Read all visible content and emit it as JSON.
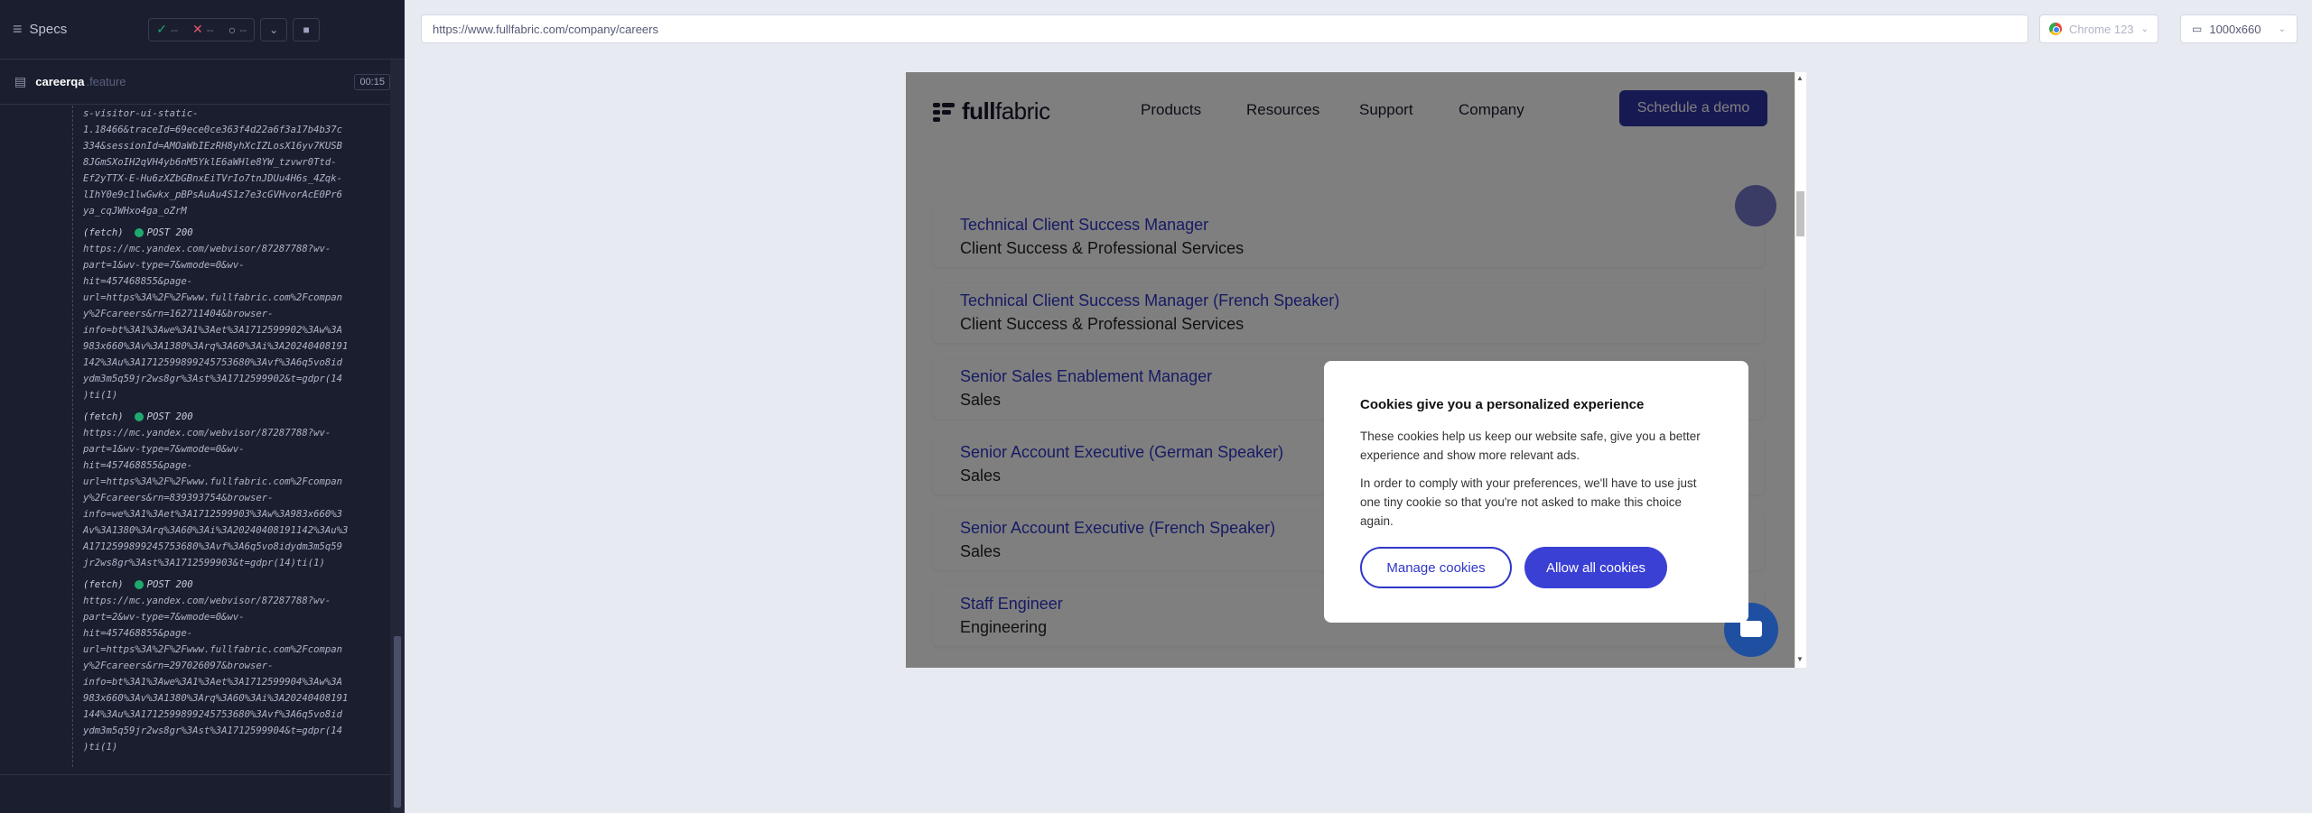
{
  "runner": {
    "title": "Specs",
    "stats": {
      "passed": "--",
      "failed": "--",
      "pending": "--"
    },
    "spec": {
      "name": "careerqa",
      "ext": ".feature",
      "time": "00:15"
    },
    "log_pre": [
      "s-visitor-ui-static-",
      "1.18466&traceId=69ece0ce363f4d22a6f3a17b4b37c",
      "334&sessionId=AMOaWbIEzRH8yhXcIZLosX16yv7KUSB",
      "8JGmSXoIH2qVH4yb6nM5YklE6aWHle8YW_tzvwr0Ttd-",
      "Ef2yTTX-E-Hu6zXZbGBnxEiTVrIo7tnJDUu4H6s_4Zqk-",
      "lIhY0e9c1lwGwkx_pBPsAuAu4S1z7e3cGVHvorAcE0Pr6",
      "ya_cqJWHxo4ga_oZrM"
    ],
    "log_entries": [
      {
        "label": "(fetch)",
        "status": "POST 200",
        "lines": [
          "https://mc.yandex.com/webvisor/87287788?wv-",
          "part=1&wv-type=7&wmode=0&wv-",
          "hit=457468855&page-",
          "url=https%3A%2F%2Fwww.fullfabric.com%2Fcompan",
          "y%2Fcareers&rn=162711404&browser-",
          "info=bt%3A1%3Awe%3A1%3Aet%3A1712599902%3Aw%3A",
          "983x660%3Av%3A1380%3Arq%3A60%3Ai%3A20240408191",
          "142%3Au%3A1712599899245753680%3Avf%3A6q5vo8id",
          "ydm3m5q59jr2ws8gr%3Ast%3A1712599902&t=gdpr(14",
          ")ti(1)"
        ]
      },
      {
        "label": "(fetch)",
        "status": "POST 200",
        "lines": [
          "https://mc.yandex.com/webvisor/87287788?wv-",
          "part=1&wv-type=7&wmode=0&wv-",
          "hit=457468855&page-",
          "url=https%3A%2F%2Fwww.fullfabric.com%2Fcompan",
          "y%2Fcareers&rn=839393754&browser-",
          "info=we%3A1%3Aet%3A1712599903%3Aw%3A983x660%3",
          "Av%3A1380%3Arq%3A60%3Ai%3A20240408191142%3Au%3",
          "A1712599899245753680%3Avf%3A6q5vo8idydm3m5q59",
          "jr2ws8gr%3Ast%3A1712599903&t=gdpr(14)ti(1)"
        ]
      },
      {
        "label": "(fetch)",
        "status": "POST 200",
        "lines": [
          "https://mc.yandex.com/webvisor/87287788?wv-",
          "part=2&wv-type=7&wmode=0&wv-",
          "hit=457468855&page-",
          "url=https%3A%2F%2Fwww.fullfabric.com%2Fcompan",
          "y%2Fcareers&rn=297026097&browser-",
          "info=bt%3A1%3Awe%3A1%3Aet%3A1712599904%3Aw%3A",
          "983x660%3Av%3A1380%3Arq%3A60%3Ai%3A20240408191",
          "144%3Au%3A1712599899245753680%3Avf%3A6q5vo8id",
          "ydm3m5q59jr2ws8gr%3Ast%3A1712599904&t=gdpr(14",
          ")ti(1)"
        ]
      }
    ]
  },
  "browser": {
    "url": "https://www.fullfabric.com/company/careers",
    "name": "Chrome 123",
    "viewport": "1000x660"
  },
  "site": {
    "logo_bold": "full",
    "logo_light": "fabric",
    "nav": [
      "Products",
      "Resources",
      "Support",
      "Company"
    ],
    "cta": "Schedule a demo",
    "jobs": [
      {
        "title": "Technical Client Success Manager",
        "dept": "Client Success & Professional Services"
      },
      {
        "title": "Technical Client Success Manager (French Speaker)",
        "dept": "Client Success & Professional Services"
      },
      {
        "title": "Senior Sales Enablement Manager",
        "dept": "Sales"
      },
      {
        "title": "Senior Account Executive (German Speaker)",
        "dept": "Sales"
      },
      {
        "title": "Senior Account Executive (French Speaker)",
        "dept": "Sales"
      },
      {
        "title": "Staff Engineer",
        "dept": "Engineering"
      }
    ]
  },
  "cookie": {
    "title": "Cookies give you a personalized experience",
    "p1": "These cookies help us keep our website safe, give you a better experience and show more relevant ads.",
    "p2": "In order to comply with your preferences, we'll have to use just one tiny cookie so that you're not asked to make this choice again.",
    "manage": "Manage cookies",
    "allow": "Allow all cookies"
  }
}
